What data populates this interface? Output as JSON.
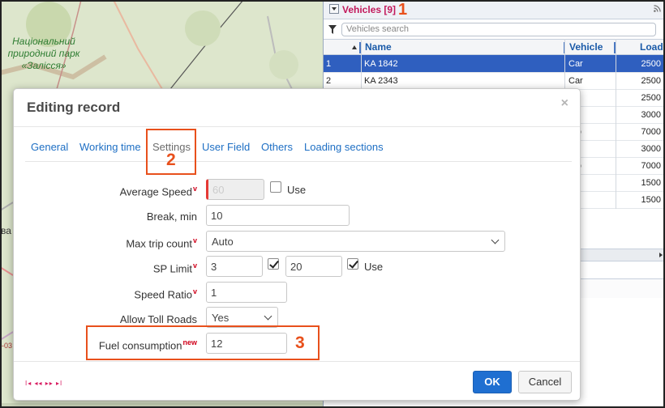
{
  "map": {
    "label": "Національний природний парк «Залісся»",
    "edge_fragments": [
      "ва",
      "-03"
    ]
  },
  "vehicles_panel": {
    "title": "Vehicles [9]",
    "search_placeholder": "Vehicles search",
    "columns": [
      "Name",
      "Vehicle",
      "Load"
    ],
    "rows": [
      {
        "num": "1",
        "name": "KA 1842",
        "vehicle": "Car",
        "load": "2500",
        "selected": true
      },
      {
        "num": "2",
        "name": "KA 2343",
        "vehicle": "Car",
        "load": "2500"
      },
      {
        "num": "",
        "name": "",
        "vehicle": "",
        "load": "2500"
      },
      {
        "num": "",
        "name": "",
        "vehicle": "",
        "load": "3000"
      },
      {
        "num": "",
        "name": "",
        "vehicle": "rgo",
        "load": "7000"
      },
      {
        "num": "",
        "name": "",
        "vehicle": "",
        "load": "3000"
      },
      {
        "num": "",
        "name": "",
        "vehicle": "rgo",
        "load": "7000"
      },
      {
        "num": "",
        "name": "",
        "vehicle": "",
        "load": "1500"
      },
      {
        "num": "",
        "name": "",
        "vehicle": "",
        "load": "1500"
      }
    ]
  },
  "annotations": {
    "n1": "1",
    "n2": "2",
    "n3": "3"
  },
  "modal": {
    "title": "Editing record",
    "close": "×",
    "tabs": [
      "General",
      "Working time",
      "Settings",
      "User Field",
      "Others",
      "Loading sections"
    ],
    "active_tab": "Settings",
    "fields": {
      "avg_speed": {
        "label": "Average Speed",
        "marker": "v",
        "value": "60",
        "use_label": "Use",
        "use_checked": false
      },
      "break_min": {
        "label": "Break, min",
        "value": "10"
      },
      "max_trip": {
        "label": "Max trip count",
        "marker": "v",
        "value": "Auto"
      },
      "sp_limit": {
        "label": "SP Limit",
        "marker": "v",
        "value1": "3",
        "value2": "20",
        "use_label": "Use",
        "check1": true,
        "check2": true
      },
      "speed_ratio": {
        "label": "Speed Ratio",
        "marker": "v",
        "value": "1"
      },
      "toll_roads": {
        "label": "Allow Toll Roads",
        "value": "Yes"
      },
      "fuel": {
        "label": "Fuel consumption",
        "marker": "new",
        "value": "12"
      }
    },
    "pager": "I◂ ◂◂ ▸▸ ▸I",
    "ok": "OK",
    "cancel": "Cancel"
  },
  "colors": {
    "accent": "#1f6fd1",
    "annotation": "#e8501c",
    "selected_row": "#2f5fbf",
    "title_pink": "#c2185b"
  }
}
